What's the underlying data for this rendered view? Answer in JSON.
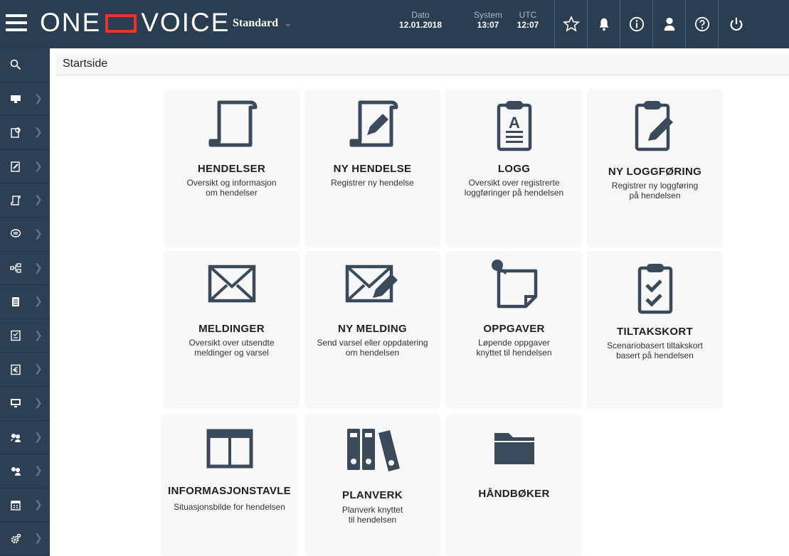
{
  "header": {
    "logo_left": "ONE",
    "logo_right": "VOICE",
    "profile": "Standard",
    "date_label": "Dato",
    "date_value": "12.01.2018",
    "system_label": "System",
    "system_value": "13:07",
    "utc_label": "UTC",
    "utc_value": "12:07"
  },
  "breadcrumb": "Startside",
  "cards": [
    {
      "title": "HENDELSER",
      "desc": "Oversikt og informasjon\nom hendelser",
      "icon": "scroll-icon"
    },
    {
      "title": "NY HENDELSE",
      "desc": "Registrer ny hendelse",
      "icon": "scroll-pencil-icon"
    },
    {
      "title": "LOGG",
      "desc": "Oversikt over registrerte\nloggføringer på hendelsen",
      "icon": "clipboard-text-icon"
    },
    {
      "title": "NY LOGGFØRING",
      "desc": "Registrer ny loggføring\npå hendelsen",
      "icon": "clipboard-pencil-icon"
    },
    {
      "title": "MELDINGER",
      "desc": "Oversikt over utsendte\nmeldinger og varsel",
      "icon": "envelope-icon"
    },
    {
      "title": "NY MELDING",
      "desc": "Send varsel eller oppdatering\nom hendelsen",
      "icon": "envelope-pencil-icon"
    },
    {
      "title": "OPPGAVER",
      "desc": "Løpende oppgaver\nknyttet til hendelsen",
      "icon": "pinned-note-icon"
    },
    {
      "title": "TILTAKSKORT",
      "desc": "Scenariobasert tiltakskort\nbasert på hendelsen",
      "icon": "clipboard-check-icon"
    },
    {
      "title": "INFORMASJONSTAVLE",
      "desc": "Situasjonsbilde for hendelsen",
      "icon": "board-icon"
    },
    {
      "title": "PLANVERK",
      "desc": "Planverk knyttet\ntil hendelsen",
      "icon": "binders-icon"
    },
    {
      "title": "HÅNDBØKER",
      "desc": "",
      "icon": "folder-icon"
    }
  ],
  "colors": {
    "topbar": "#2a3e52",
    "sidebar": "#2d3f53",
    "logo_accent": "#e8352e",
    "icon": "#3a4a5a"
  }
}
